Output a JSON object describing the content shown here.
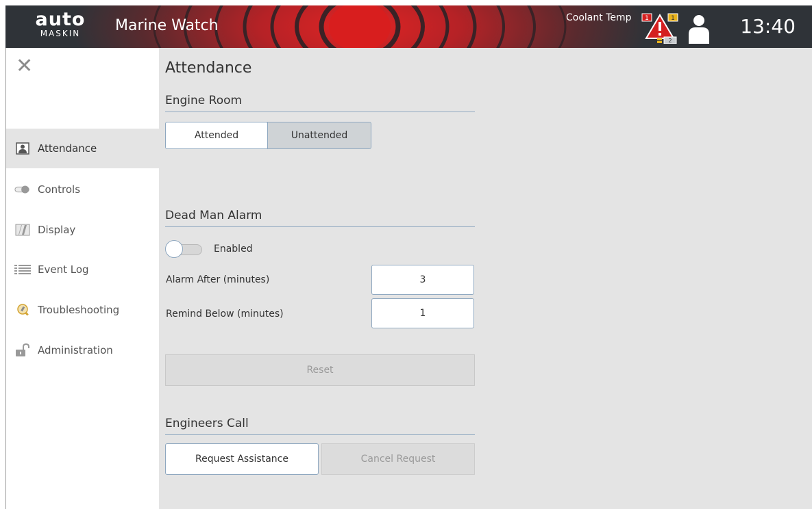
{
  "header": {
    "logo_main": "auto",
    "logo_sub": "MASKIN",
    "app_title": "Marine Watch",
    "alarm_text": "Coolant Temp",
    "alarm_badge_red": "1",
    "alarm_badge_yellow": "1",
    "alarm_badge_gray": "2",
    "clock": "13:40",
    "alarm_color": "#d42020"
  },
  "sidebar": {
    "items": [
      {
        "label": "Attendance",
        "icon": "person-icon"
      },
      {
        "label": "Controls",
        "icon": "toggle-icon"
      },
      {
        "label": "Display",
        "icon": "display-icon"
      },
      {
        "label": "Event Log",
        "icon": "list-icon"
      },
      {
        "label": "Troubleshooting",
        "icon": "wrench-search-icon"
      },
      {
        "label": "Administration",
        "icon": "unlocked-icon"
      }
    ]
  },
  "main": {
    "title": "Attendance",
    "engine_room": {
      "title": "Engine Room",
      "attended_label": "Attended",
      "unattended_label": "Unattended",
      "selected": "Attended"
    },
    "dead_man": {
      "title": "Dead Man Alarm",
      "enabled_label": "Enabled",
      "enabled": false,
      "alarm_after_label": "Alarm After (minutes)",
      "alarm_after_value": "3",
      "remind_below_label": "Remind Below (minutes)",
      "remind_below_value": "1",
      "reset_label": "Reset"
    },
    "engineers_call": {
      "title": "Engineers Call",
      "request_label": "Request Assistance",
      "cancel_label": "Cancel Request"
    }
  }
}
